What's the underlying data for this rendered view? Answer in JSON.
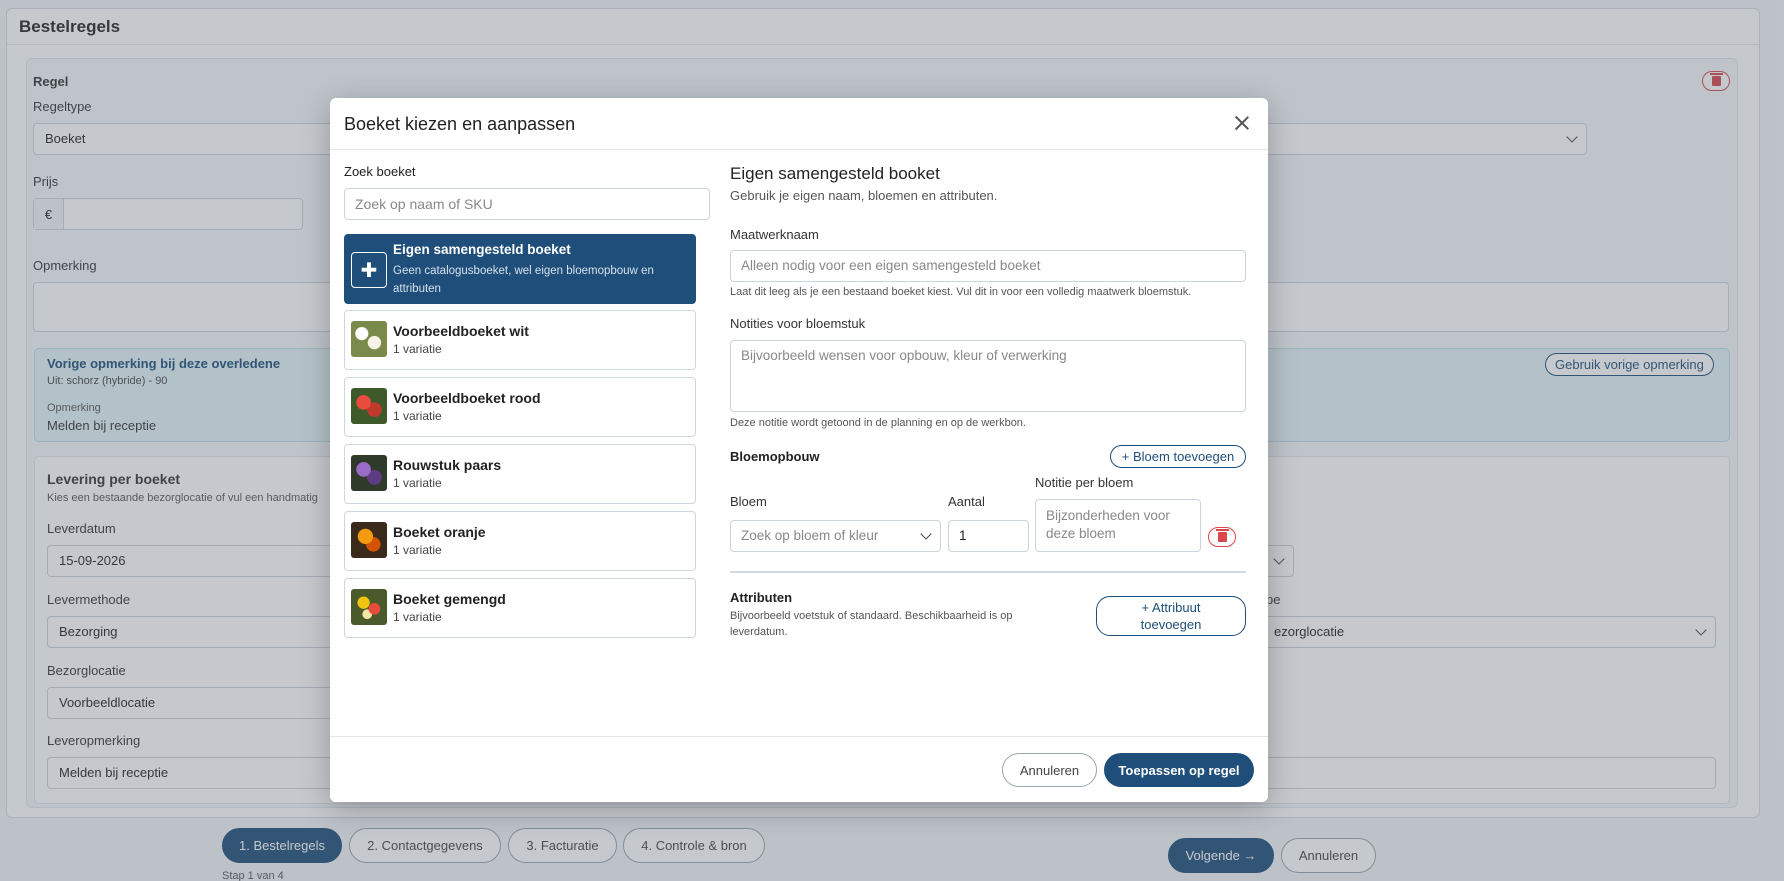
{
  "page": {
    "card_title": "Bestelregels",
    "regel": {
      "title": "Regel",
      "regeltype_label": "Regeltype",
      "regeltype_value": "Boeket",
      "prijs_label": "Prijs",
      "currency": "€",
      "opmerking_label": "Opmerking"
    },
    "previous": {
      "title": "Vorige opmerking bij deze overledene",
      "from": "Uit: schorz (hybride) - 90",
      "opmerking_label": "Opmerking",
      "opmerking_value": "Melden bij receptie",
      "use_button": "Gebruik vorige opmerking"
    },
    "levering": {
      "title": "Levering per boeket",
      "subtitle": "Kies een bestaande bezorglocatie of vul een handmatig",
      "leverdatum_label": "Leverdatum",
      "leverdatum_value": "15-09-2026",
      "levermethode_label": "Levermethode",
      "levermethode_value": "Bezorging",
      "bezorglocatie_label": "Bezorglocatie",
      "bezorglocatie_value": "Voorbeeldlocatie",
      "leveropmerking_label": "Leveropmerking",
      "leveropmerking_value": "Melden bij receptie",
      "right_label_fragment": "pe",
      "right_select_fragment": "ezorglocatie"
    }
  },
  "footer": {
    "steps": [
      "1. Bestelregels",
      "2. Contactgegevens",
      "3. Facturatie",
      "4. Controle & bron"
    ],
    "step_note": "Stap 1 van 4",
    "next_button": "Volgende →",
    "cancel_button": "Annuleren"
  },
  "modal": {
    "title": "Boeket kiezen en aanpassen",
    "search_label": "Zoek boeket",
    "search_placeholder": "Zoek op naam of SKU",
    "items": [
      {
        "name": "Eigen samengesteld boeket",
        "sub": "Geen catalogusboeket, wel eigen bloemopbouw en attributen",
        "selected": true
      },
      {
        "name": "Voorbeeldboeket wit",
        "sub": "1 variatie",
        "color": "#e8e4d4"
      },
      {
        "name": "Voorbeeldboeket rood",
        "sub": "1 variatie",
        "color": "#c0392b"
      },
      {
        "name": "Rouwstuk paars",
        "sub": "1 variatie",
        "color": "#6c4a8e"
      },
      {
        "name": "Boeket oranje",
        "sub": "1 variatie",
        "color": "#e67e22"
      },
      {
        "name": "Boeket gemengd",
        "sub": "1 variatie",
        "color": "#c8a13a"
      }
    ],
    "detail": {
      "title": "Eigen samengesteld booket",
      "subtitle": "Gebruik je eigen naam, bloemen en attributen.",
      "maatwerk_label": "Maatwerknaam",
      "maatwerk_placeholder": "Alleen nodig voor een eigen samengesteld boeket",
      "maatwerk_hint": "Laat dit leeg als je een bestaand boeket kiest. Vul dit in voor een volledig maatwerk bloemstuk.",
      "notities_label": "Notities voor bloemstuk",
      "notities_placeholder": "Bijvoorbeeld wensen voor opbouw, kleur of verwerking",
      "notities_hint": "Deze notitie wordt getoond in de planning en op de werkbon.",
      "bloemopbouw_title": "Bloemopbouw",
      "bloem_add": "+ Bloem toevoegen",
      "bloem_label": "Bloem",
      "aantal_label": "Aantal",
      "notitie_label": "Notitie per bloem",
      "bloem_placeholder": "Zoek op bloem of kleur",
      "aantal_value": "1",
      "notitie_placeholder": "Bijzonderheden voor deze bloem",
      "attributen_title": "Attributen",
      "attributen_hint": "Bijvoorbeeld voetstuk of standaard. Beschikbaarheid is op leverdatum.",
      "attribuut_add": "+ Attribuut toevoegen"
    },
    "cancel": "Annuleren",
    "apply": "Toepassen op regel"
  },
  "colors": {
    "primary": "#1e4e79",
    "danger": "#d9464c",
    "info_bg": "#e3f3f7"
  }
}
